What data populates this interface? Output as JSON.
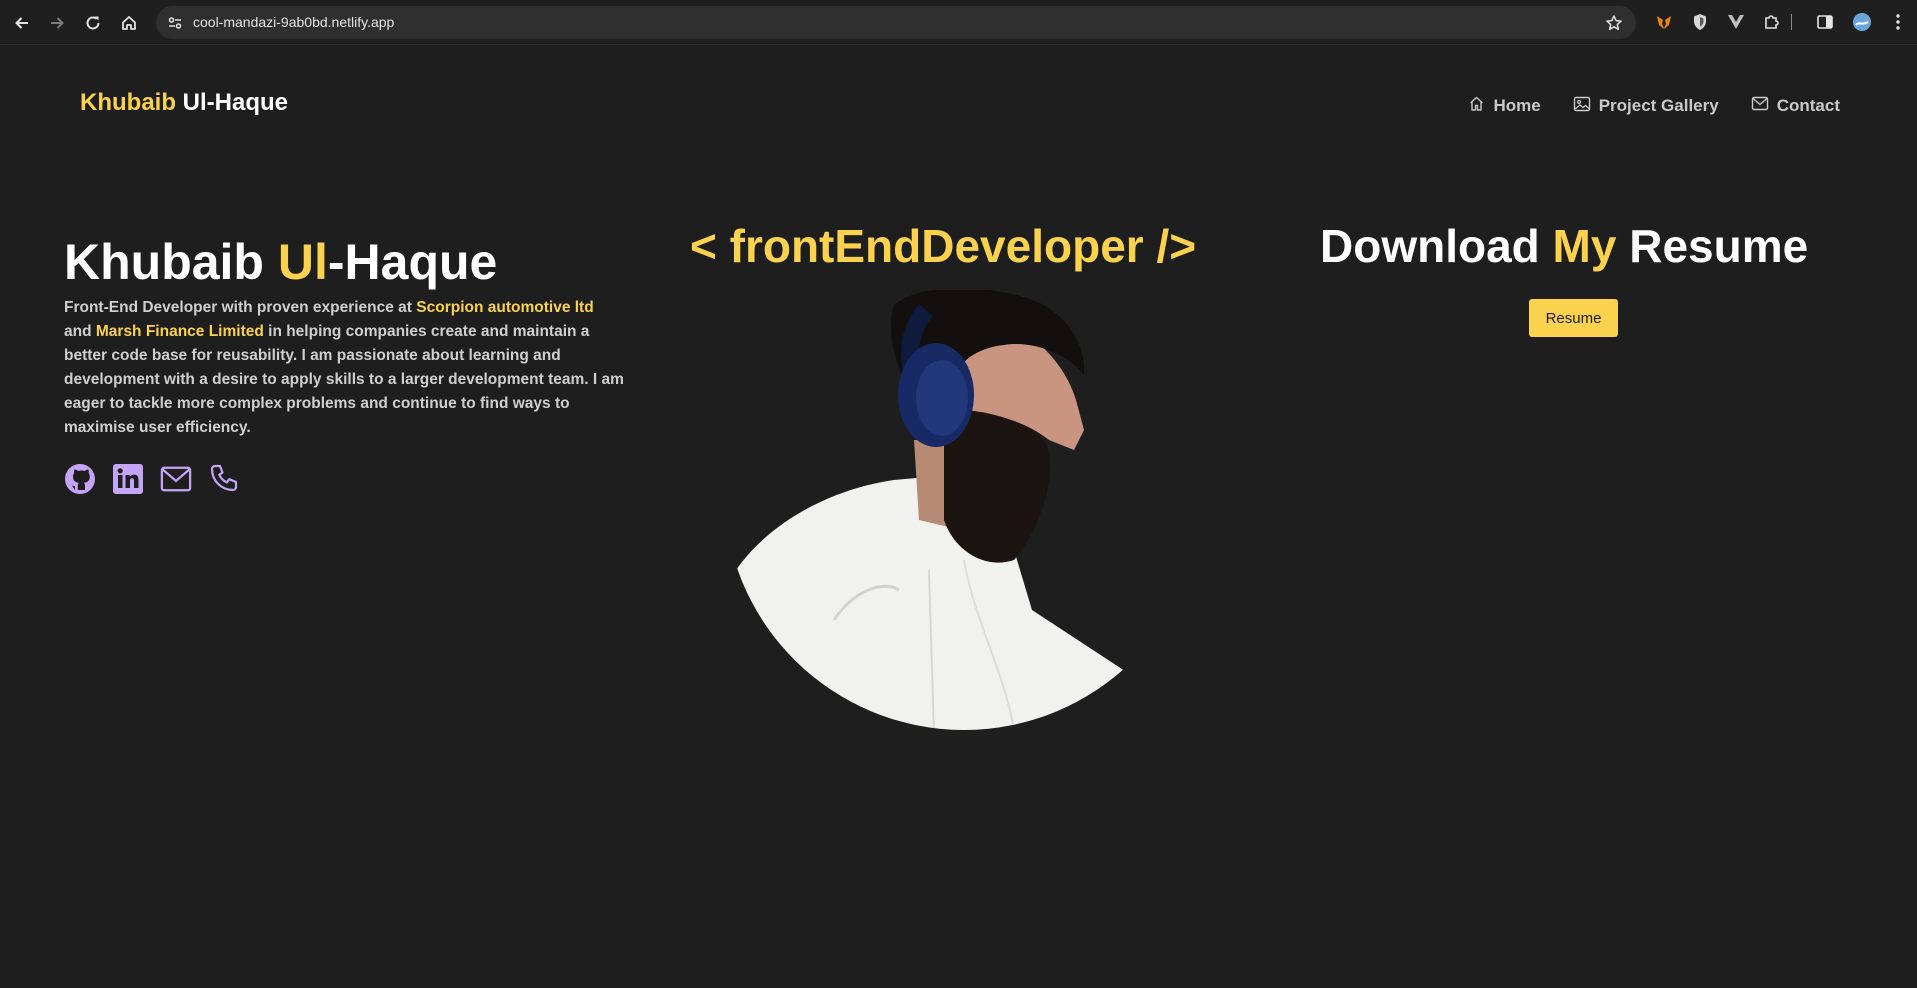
{
  "browser": {
    "url": "cool-mandazi-9ab0bd.netlify.app",
    "icons": [
      "back-icon",
      "forward-icon",
      "reload-icon",
      "home-icon",
      "site-info-icon",
      "bookmark-star-icon",
      "metamask-extension-icon",
      "shield-extension-icon",
      "vue-extension-icon",
      "extensions-puzzle-icon",
      "side-panel-icon",
      "profile-avatar-icon",
      "menu-kebab-icon"
    ]
  },
  "header": {
    "brand_first": "Khubaib",
    "brand_rest": " Ul-Haque",
    "nav": [
      {
        "label": "Home",
        "icon": "house-icon"
      },
      {
        "label": "Project Gallery",
        "icon": "image-icon"
      },
      {
        "label": "Contact",
        "icon": "mail-icon"
      }
    ]
  },
  "hero": {
    "name_first": "Khubaib ",
    "name_highlight": "Ul",
    "name_rest": "-Haque",
    "bio": {
      "part1": "Front-End Developer with proven experience at ",
      "company1": "Scorpion automotive ltd",
      "part2": " and ",
      "company2": "Marsh Finance Limited",
      "part3": " in helping companies create and maintain a better code base for reusability. I am passionate about learning and development with a desire to apply skills to a larger development team. I am eager to tackle more complex problems and continue to find ways to maximise user efficiency."
    },
    "socials": [
      "github-icon",
      "linkedin-icon",
      "email-icon",
      "phone-icon"
    ],
    "role_text": "< frontEndDeveloper />",
    "resume_title_1": "Download ",
    "resume_title_highlight": "My",
    "resume_title_2": " Resume",
    "resume_button": "Resume"
  },
  "colors": {
    "background": "#1e1e1e",
    "accent": "#fbd24e",
    "icon_purple": "#c4a4f7"
  }
}
